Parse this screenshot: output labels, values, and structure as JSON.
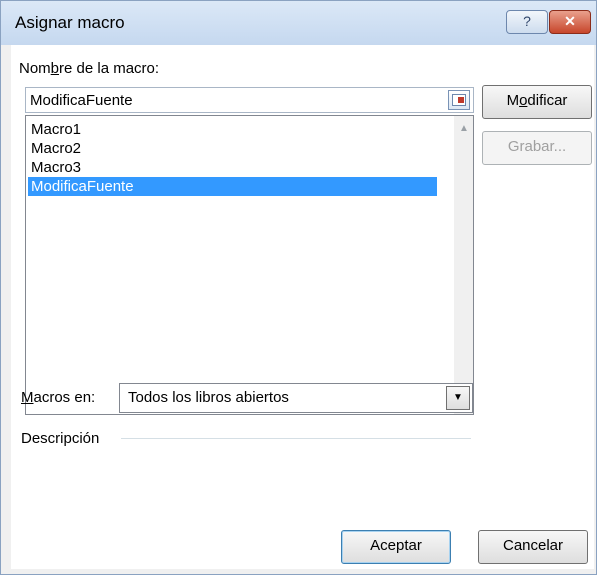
{
  "window": {
    "title": "Asignar macro",
    "help_glyph": "?",
    "close_glyph": "✕"
  },
  "name_label": {
    "pre": "Nom",
    "accel": "b",
    "post": "re de la macro:"
  },
  "name_input_value": "ModificaFuente",
  "macro_list": [
    {
      "label": "Macro1",
      "selected": false
    },
    {
      "label": "Macro2",
      "selected": false
    },
    {
      "label": "Macro3",
      "selected": false
    },
    {
      "label": "ModificaFuente",
      "selected": true
    }
  ],
  "buttons": {
    "modificar": {
      "pre": "M",
      "accel": "o",
      "post": "dificar"
    },
    "grabar": "Grabar...",
    "aceptar": "Aceptar",
    "cancelar": "Cancelar"
  },
  "macros_en": {
    "label_accel": "M",
    "label_post": "acros en:",
    "selected": "Todos los libros abiertos"
  },
  "descripcion_label": "Descripción",
  "colors": {
    "selection": "#3399ff",
    "title_bar": "#c5d8ef",
    "close": "#c7462b"
  }
}
